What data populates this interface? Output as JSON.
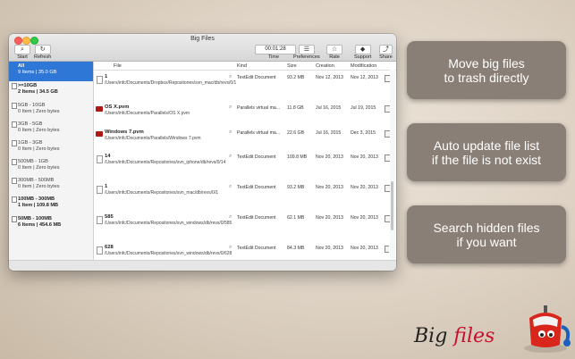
{
  "window": {
    "title": "Big Files"
  },
  "toolbar": {
    "start_label": "Start",
    "refresh_label": "Refresh",
    "timer_value": "00:01:28",
    "time_label": "Time",
    "preferences_label": "Preferences",
    "rate_label": "Rate",
    "support_label": "Support",
    "share_label": "Share"
  },
  "sidebar": {
    "items": [
      {
        "name": "All",
        "count": "9 Items | 35.0 GB"
      },
      {
        "name": ">=10GB",
        "count": "2 Items | 34.5 GB"
      },
      {
        "name": "5GB - 10GB",
        "count": "0 Item | Zero bytes"
      },
      {
        "name": "3GB - 5GB",
        "count": "0 Item | Zero bytes"
      },
      {
        "name": "1GB - 3GB",
        "count": "0 Item | Zero bytes"
      },
      {
        "name": "500MB - 1GB",
        "count": "0 Item | Zero bytes"
      },
      {
        "name": "300MB - 500MB",
        "count": "0 Item | Zero bytes"
      },
      {
        "name": "100MB - 300MB",
        "count": "1 Item | 109.8 MB"
      },
      {
        "name": "50MB - 100MB",
        "count": "6 Items | 454.6 MB"
      }
    ]
  },
  "table": {
    "headers": {
      "file": "File",
      "kind": "Kind",
      "size": "Size",
      "creation": "Creation",
      "modification": "Modification"
    },
    "rows": [
      {
        "icon": "document",
        "name": "1",
        "path": "/Users/infc/Documents/Dropbox/Repositories/svn_mac/db/revs/0/1",
        "kind": "TextEdit Document",
        "size": "93.2 MB",
        "creation": "Nov 12, 2013",
        "modification": "Nov 12, 2013"
      },
      {
        "icon": "pvm",
        "name": "OS X.pvm",
        "path": "/Users/infc/Documents/Parallels/OS X.pvm",
        "kind": "Parallels virtual ma...",
        "size": "11.8 GB",
        "creation": "Jul 16, 2015",
        "modification": "Jul 19, 2015"
      },
      {
        "icon": "pvm",
        "name": "Windows 7.pvm",
        "path": "/Users/infc/Documents/Parallels/Windows 7.pvm",
        "kind": "Parallels virtual ma...",
        "size": "22.6 GB",
        "creation": "Jul 16, 2015",
        "modification": "Dec 3, 2015"
      },
      {
        "icon": "document",
        "name": "14",
        "path": "/Users/infc/Documents/Repositories/svn_iphone/db/revs/0/14",
        "kind": "TextEdit Document",
        "size": "109.8 MB",
        "creation": "Nov 20, 2013",
        "modification": "Nov 20, 2013"
      },
      {
        "icon": "document",
        "name": "1",
        "path": "/Users/infc/Documents/Repositories/svn_mac/db/revs/0/1",
        "kind": "TextEdit Document",
        "size": "93.2 MB",
        "creation": "Nov 20, 2013",
        "modification": "Nov 20, 2013"
      },
      {
        "icon": "document",
        "name": "585",
        "path": "/Users/infc/Documents/Repositories/svn_windows/db/revs/0/585",
        "kind": "TextEdit Document",
        "size": "62.1 MB",
        "creation": "Nov 20, 2013",
        "modification": "Nov 20, 2013"
      },
      {
        "icon": "document",
        "name": "628",
        "path": "/Users/infc/Documents/Repositories/svn_windows/db/revs/0/628",
        "kind": "TextEdit Document",
        "size": "84.3 MB",
        "creation": "Nov 20, 2013",
        "modification": "Nov 20, 2013"
      }
    ]
  },
  "features": [
    {
      "line1": "Move big files",
      "line2": "to trash directly"
    },
    {
      "line1": "Auto update file list",
      "line2": "if the file is not exist"
    },
    {
      "line1": "Search hidden files",
      "line2": "if you want"
    }
  ],
  "brand": {
    "word1": "Big",
    "word2": "files"
  },
  "colors": {
    "selection": "#2f77d6",
    "bubble": "#8a7f76",
    "pvm_icon": "#b01818",
    "brand_accent": "#c8102e"
  }
}
